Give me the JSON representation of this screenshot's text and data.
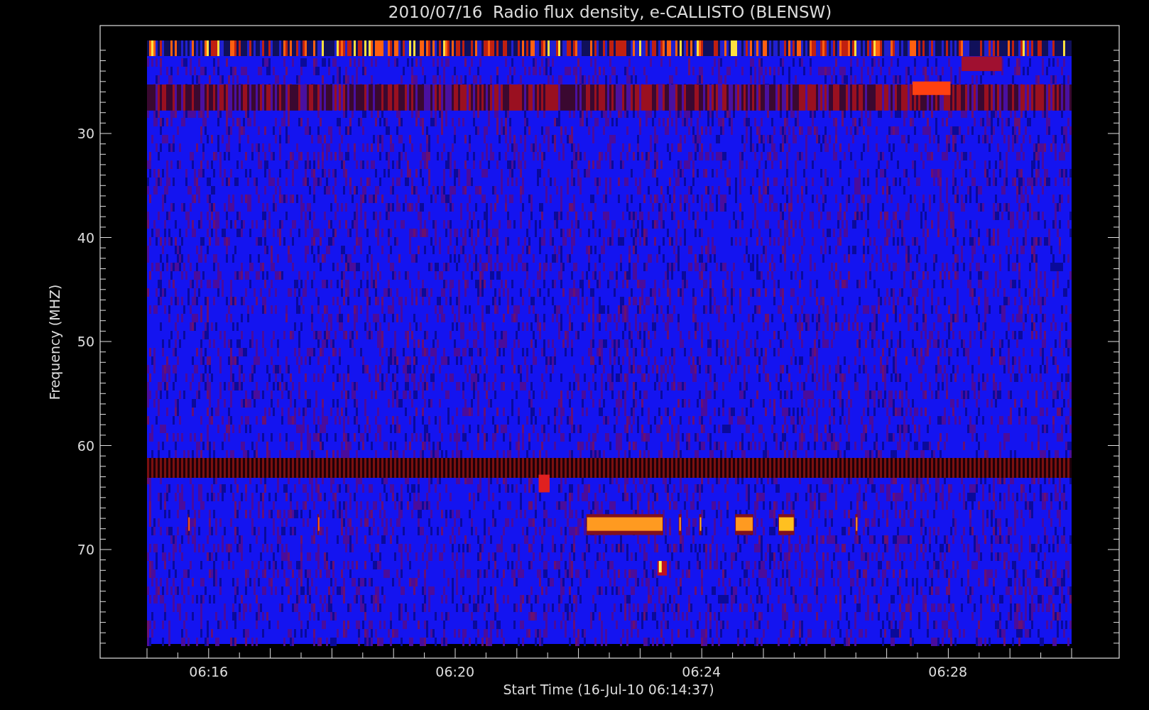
{
  "title": "2010/07/16  Radio flux density, e-CALLISTO (BLENSW)",
  "y_axis": {
    "label": "Frequency (MHZ)",
    "ticks": [
      "30",
      "40",
      "50",
      "60",
      "70"
    ]
  },
  "x_axis": {
    "label": "Start Time (16-Jul-10 06:14:37)",
    "ticks": [
      "06:16",
      "06:20",
      "06:24",
      "06:28"
    ]
  }
}
